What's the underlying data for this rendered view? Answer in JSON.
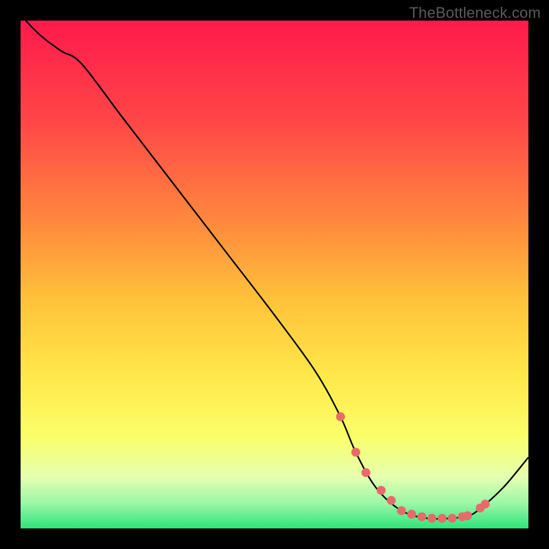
{
  "watermark": "TheBottleneck.com",
  "chart_data": {
    "type": "line",
    "title": "",
    "xlabel": "",
    "ylabel": "",
    "xlim": [
      0,
      100
    ],
    "ylim": [
      0,
      100
    ],
    "grid": false,
    "series": [
      {
        "name": "curve",
        "x": [
          1,
          4,
          8,
          12,
          20,
          30,
          40,
          50,
          58,
          63,
          66,
          70,
          75,
          80,
          85,
          88,
          90,
          95,
          100
        ],
        "y": [
          100,
          97,
          94,
          91.5,
          81,
          68,
          55,
          42,
          31,
          22,
          15,
          8,
          3.5,
          2,
          2,
          2.5,
          3.5,
          8,
          14
        ]
      }
    ],
    "markers": {
      "name": "highlight-dots",
      "color": "#e86a6a",
      "x": [
        63,
        66,
        68,
        71,
        73,
        75,
        77,
        79,
        81,
        83,
        85,
        87,
        88,
        90.5,
        91.5
      ],
      "y": [
        22,
        15,
        11,
        7.5,
        5.5,
        3.5,
        2.8,
        2.3,
        2,
        2,
        2,
        2.3,
        2.5,
        4,
        4.8
      ]
    },
    "background_gradient": {
      "stops": [
        {
          "offset": 0.0,
          "color": "#ff1a4d"
        },
        {
          "offset": 0.2,
          "color": "#ff4747"
        },
        {
          "offset": 0.4,
          "color": "#ff8a3d"
        },
        {
          "offset": 0.55,
          "color": "#ffc23a"
        },
        {
          "offset": 0.7,
          "color": "#ffe84a"
        },
        {
          "offset": 0.82,
          "color": "#fbff6a"
        },
        {
          "offset": 0.9,
          "color": "#e4ffb0"
        },
        {
          "offset": 0.95,
          "color": "#9cf7a8"
        },
        {
          "offset": 1.0,
          "color": "#2fe47a"
        }
      ]
    }
  }
}
